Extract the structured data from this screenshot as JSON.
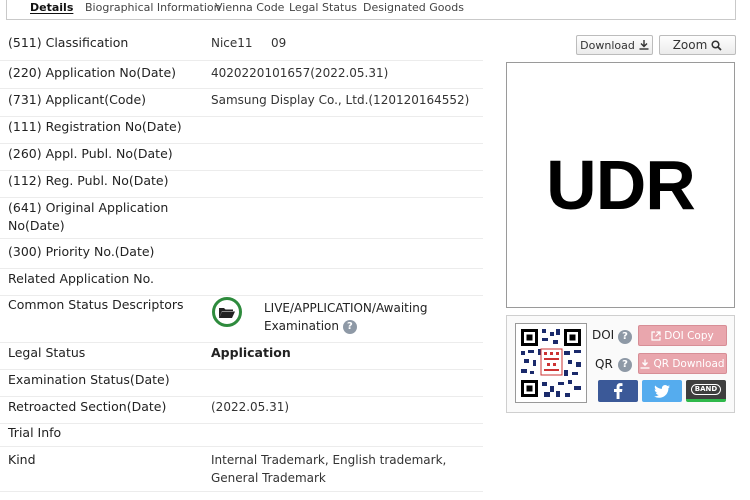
{
  "tabs": [
    {
      "label": "Details",
      "active": true
    },
    {
      "label": "Biographical Information"
    },
    {
      "label": "Vienna Code"
    },
    {
      "label": "Legal Status"
    },
    {
      "label": "Designated Goods"
    }
  ],
  "fields": {
    "classification": {
      "label": "(511) Classification",
      "value_nice": "Nice11",
      "value_class": "09"
    },
    "application_no": {
      "label": "(220) Application No(Date)",
      "value": "4020220101657(2022.05.31)"
    },
    "applicant": {
      "label": "(731) Applicant(Code)",
      "value": "Samsung Display Co., Ltd.(120120164552)"
    },
    "registration_no": {
      "label": "(111) Registration No(Date)",
      "value": ""
    },
    "appl_publ_no": {
      "label": "(260) Appl. Publ. No(Date)",
      "value": ""
    },
    "reg_publ_no": {
      "label": "(112) Reg. Publ. No(Date)",
      "value": ""
    },
    "original_application": {
      "label": "(641) Original Application No(Date)",
      "value": ""
    },
    "priority_no": {
      "label": "(300) Priority No.(Date)",
      "value": ""
    },
    "related_application": {
      "label": "Related Application No.",
      "value": ""
    },
    "common_status": {
      "label": "Common Status Descriptors",
      "value": "LIVE/APPLICATION/Awaiting Examination"
    },
    "legal_status": {
      "label": "Legal Status",
      "value": "Application"
    },
    "examination_status": {
      "label": "Examination Status(Date)",
      "value": ""
    },
    "retroacted_section": {
      "label": "Retroacted Section(Date)",
      "value": "(2022.05.31)"
    },
    "trial_info": {
      "label": "Trial Info",
      "value": ""
    },
    "kind": {
      "label": "Kind",
      "value": "Internal Trademark, English trademark, General Trademark"
    }
  },
  "buttons": {
    "download": "Download",
    "zoom": "Zoom"
  },
  "trademark": {
    "text": "UDR"
  },
  "share": {
    "doi_label": "DOI",
    "qr_label": "QR",
    "doi_copy": "DOI Copy",
    "qr_download": "QR Download",
    "band": "BAND",
    "help": "?"
  },
  "colors": {
    "status_green": "#2e8b3d",
    "pink_button": "#e9a6ad",
    "facebook": "#3b5998",
    "twitter": "#55acee",
    "band": "#3e3e3e"
  }
}
